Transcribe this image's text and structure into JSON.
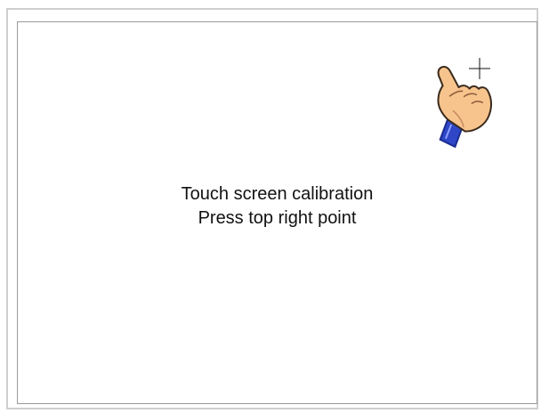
{
  "calibration": {
    "line1": "Touch screen calibration",
    "line2": "Press top right point"
  },
  "icons": {
    "pointer": "pointing-hand-icon",
    "target": "crosshair-target-icon"
  },
  "colors": {
    "background": "#ffffff",
    "text": "#111111",
    "frame_border": "#cfcfcf",
    "screen_border": "#9a9a9a",
    "hand_skin": "#f7c48d",
    "hand_outline": "#3b2a1d",
    "cuff": "#2f47c7"
  }
}
